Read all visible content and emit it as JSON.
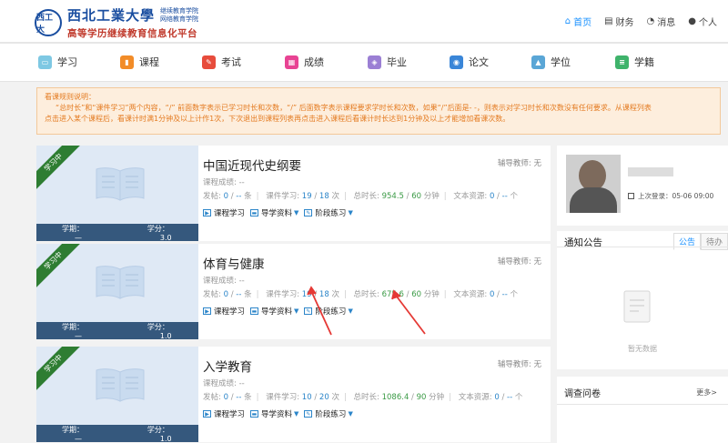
{
  "header": {
    "seal_text": "西工大",
    "university_name": "西北工業大學",
    "college_line1": "继续教育学院",
    "college_line2": "网络教育学院",
    "platform_name": "高等学历继续教育信息化平台",
    "nav": [
      {
        "label": "首页",
        "icon": "home-icon",
        "active": true
      },
      {
        "label": "财务",
        "icon": "wallet-icon",
        "active": false
      },
      {
        "label": "消息",
        "icon": "bell-icon",
        "active": false
      },
      {
        "label": "个人",
        "icon": "user-icon",
        "active": false
      }
    ]
  },
  "main_nav": [
    {
      "label": "学习",
      "icon": "study-icon",
      "color": "#7ec8e3"
    },
    {
      "label": "课程",
      "icon": "course-icon",
      "color": "#f28c28"
    },
    {
      "label": "考试",
      "icon": "exam-icon",
      "color": "#e74c3c"
    },
    {
      "label": "成绩",
      "icon": "grade-icon",
      "color": "#e84393"
    },
    {
      "label": "毕业",
      "icon": "graduation-icon",
      "color": "#9b7fd4"
    },
    {
      "label": "论文",
      "icon": "paper-icon",
      "color": "#3a86d8"
    },
    {
      "label": "学位",
      "icon": "degree-cap-icon",
      "color": "#5aa6d6"
    },
    {
      "label": "学籍",
      "icon": "registry-icon",
      "color": "#3fb36b"
    }
  ],
  "notice": {
    "title": "看课规则说明：",
    "line1": "“总时长”和“课件学习”两个内容，“/” 前面数字表示已学习时长和次数，“/” 后面数字表示课程要求学时长和次数，如果“/”后面是- -，则表示对学习时长和次数没有任何要求。从课程列表",
    "line2": "点击进入某个课程后，看课计时满1分钟及以上计作1次，下次退出到课程列表再点击进入课程后看课计时长达到1分钟及以上才能增加看课次数。"
  },
  "course_labels": {
    "status": "学习中",
    "term_prefix": "学期：",
    "credit_prefix": "学分：",
    "tutor_label": "辅导教师: 无",
    "score_label": "课程成绩: --",
    "posts_label": "发帖:",
    "courseware_label": "课件学习:",
    "total_time_label": "总时长:",
    "resources_label": "文本资源:",
    "unit_items": "条",
    "unit_times": "次",
    "unit_minutes": "分钟",
    "unit_count": "个",
    "action_learn": "课程学习",
    "action_guide": "导学资料",
    "action_practice": "阶段练习"
  },
  "courses": [
    {
      "title": "中国近现代史纲要",
      "term": "—",
      "credit": "3.0",
      "posts_done": "0",
      "posts_req": "--",
      "courseware_done": "19",
      "courseware_req": "18",
      "time_done": "954.5",
      "time_req": "60",
      "resources_done": "0",
      "resources_req": "--"
    },
    {
      "title": "体育与健康",
      "term": "—",
      "credit": "1.0",
      "posts_done": "0",
      "posts_req": "--",
      "courseware_done": "19",
      "courseware_req": "18",
      "time_done": "675.6",
      "time_req": "60",
      "resources_done": "0",
      "resources_req": "--"
    },
    {
      "title": "入学教育",
      "term": "—",
      "credit": "1.0",
      "posts_done": "0",
      "posts_req": "--",
      "courseware_done": "10",
      "courseware_req": "20",
      "time_done": "1086.4",
      "time_req": "90",
      "resources_done": "0",
      "resources_req": "--"
    }
  ],
  "sidebar": {
    "last_login": "上次登录：05-06 09:00",
    "notice_title": "通知公告",
    "tabs": [
      "公告",
      "待办"
    ],
    "empty_text": "暂无数据",
    "survey_title": "调查问卷",
    "more": "更多>"
  },
  "colors": {
    "accent": "#1890ff",
    "ribbon": "#2e7d32",
    "bar": "#35587d",
    "notice_text": "#e47b21",
    "arrow": "#e53935"
  }
}
